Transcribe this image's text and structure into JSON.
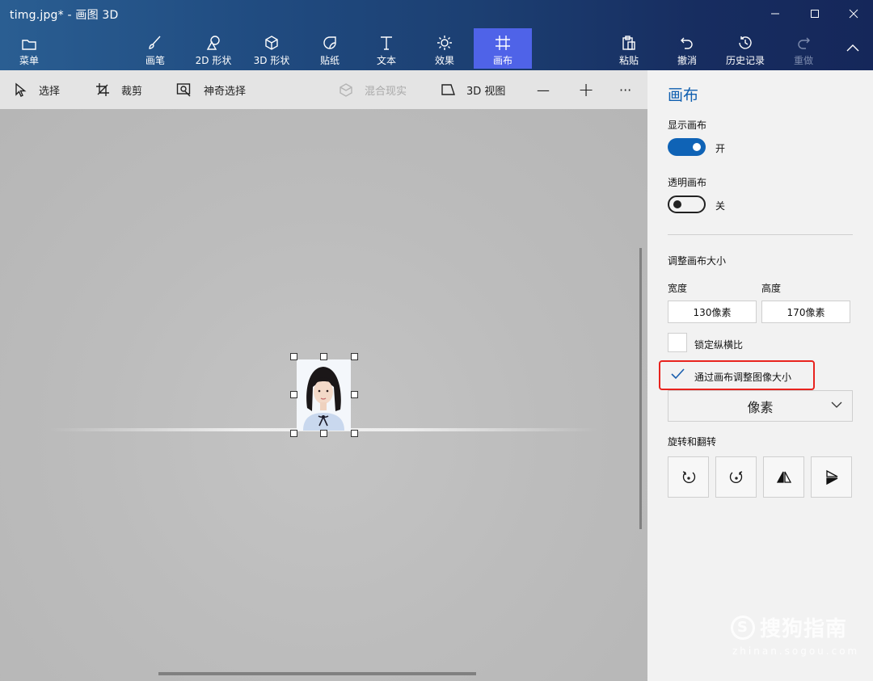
{
  "window": {
    "title": "timg.jpg* - 画图 3D"
  },
  "ribbon": {
    "menu": "菜单",
    "brushes": "画笔",
    "shapes2d": "2D 形状",
    "shapes3d": "3D 形状",
    "stickers": "贴纸",
    "text": "文本",
    "effects": "效果",
    "canvas": "画布",
    "paste": "粘贴",
    "undo": "撤消",
    "history": "历史记录",
    "redo": "重做"
  },
  "toolbar": {
    "select": "选择",
    "crop": "裁剪",
    "magic_select": "神奇选择",
    "mixed_reality": "混合现实",
    "view3d": "3D 视图",
    "zoom_out": "—",
    "zoom_in": "+",
    "more": "···"
  },
  "panel": {
    "title": "画布",
    "show_canvas_label": "显示画布",
    "show_canvas_state": "开",
    "transparent_canvas_label": "透明画布",
    "transparent_canvas_state": "关",
    "resize_label": "调整画布大小",
    "width_label": "宽度",
    "height_label": "高度",
    "width_value": "130像素",
    "height_value": "170像素",
    "lock_aspect_label": "锁定纵横比",
    "resize_image_label": "通过画布调整图像大小",
    "unit_value": "像素",
    "rotate_flip_label": "旋转和翻转"
  },
  "watermark": {
    "logo_letter": "S",
    "text": "搜狗指南",
    "url": "zhinan.sogou.com"
  },
  "colors": {
    "accent": "#0f63b6",
    "active_tab": "#4f63e8",
    "highlight": "#e8231e"
  }
}
